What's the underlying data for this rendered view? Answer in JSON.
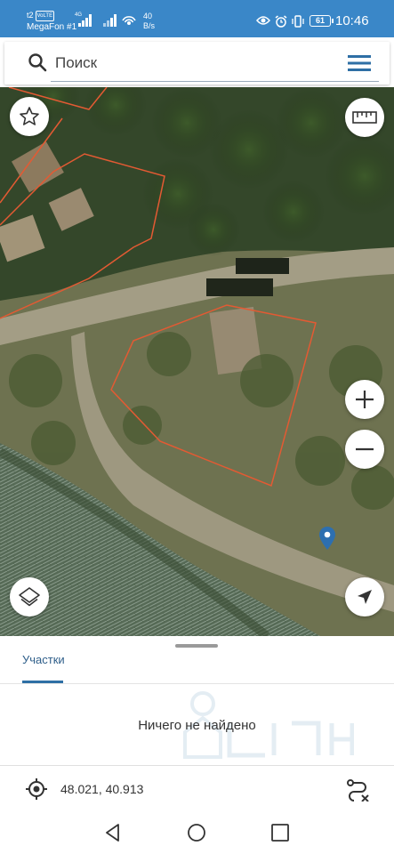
{
  "status_bar": {
    "carrier": "t2",
    "carrier_badge": "VoLTE",
    "operator": "MegaFon #1",
    "network_type": "4G",
    "speed_value": "40",
    "speed_unit": "B/s",
    "battery": "61",
    "time": "10:46"
  },
  "search": {
    "placeholder": "Поиск",
    "value": ""
  },
  "map": {
    "parcel_outline_color": "#e35a33",
    "buttons": [
      "favorites-star",
      "ruler",
      "zoom-in",
      "zoom-out",
      "layers",
      "my-location"
    ]
  },
  "sheet": {
    "tab_label": "Участки",
    "empty_message": "Ничего не найдено",
    "coordinates": "48.021, 40.913"
  },
  "colors": {
    "status_bar": "#3a87c8",
    "accent": "#2e6fa5"
  }
}
